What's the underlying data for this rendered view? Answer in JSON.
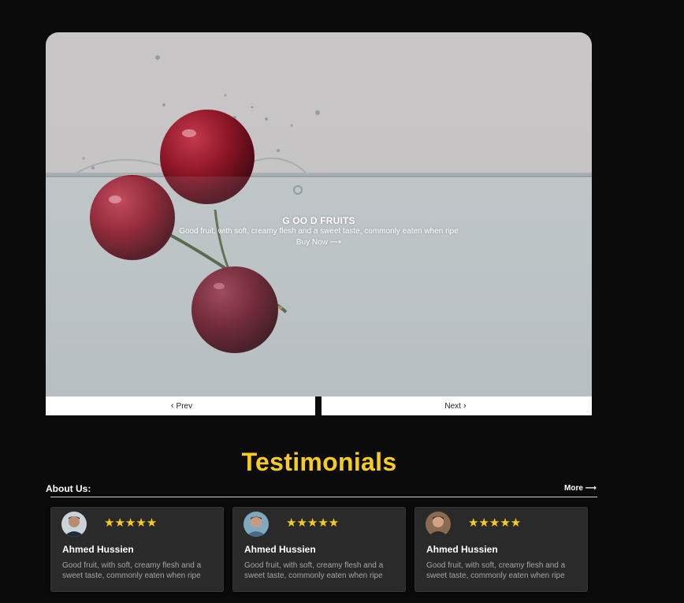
{
  "slider": {
    "title": "G OO D FRUITS",
    "description": "Good fruit, with soft, creamy flesh and a sweet taste, commonly eaten when ripe",
    "cta": "Buy Now ⟶",
    "prev_label": "Prev",
    "next_label": "Next",
    "prev_icon": "chevron-left-icon",
    "next_icon": "chevron-right-icon"
  },
  "testimonials": {
    "heading": "Testimonials",
    "about_label": "About Us:",
    "more_label": "More ⟶",
    "cards": [
      {
        "name": "Ahmed Hussien",
        "stars": "★★★★★",
        "rating": 5,
        "text": "Good fruit, with soft, creamy flesh and a sweet taste, commonly eaten when ripe"
      },
      {
        "name": "Ahmed Hussien",
        "stars": "★★★★★",
        "rating": 5,
        "text": "Good fruit, with soft, creamy flesh and a sweet taste, commonly eaten when ripe"
      },
      {
        "name": "Ahmed Hussien",
        "stars": "★★★★★",
        "rating": 5,
        "text": "Good fruit, with soft, creamy flesh and a sweet taste, commonly eaten when ripe"
      }
    ]
  },
  "colors": {
    "accent": "#f7cd1d",
    "background": "#0b0b0b",
    "card": "#2a2a2a"
  }
}
